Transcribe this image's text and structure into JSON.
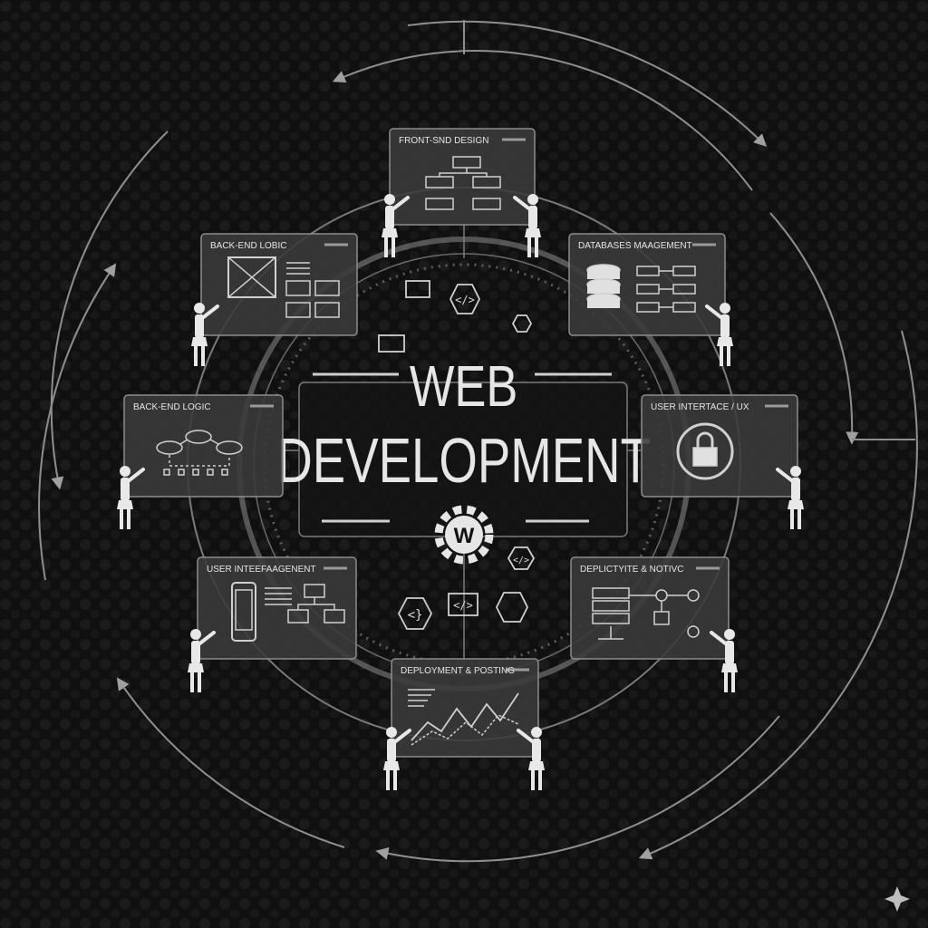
{
  "title": {
    "line1": "WEB",
    "line2": "DEVELOPMENT"
  },
  "center_logo_letter": "W",
  "panels": [
    {
      "id": "front-end-design",
      "label": "FRONT-SND DESIGN",
      "icon": "flowchart-icon"
    },
    {
      "id": "database-management",
      "label": "DATABASES MAAGEMENT",
      "icon": "database-icon"
    },
    {
      "id": "user-interface-ux",
      "label": "USER INTERTACE / UX",
      "icon": "lock-icon"
    },
    {
      "id": "deployment-hosting-right",
      "label": "DEPLICTYITE & NOTIVC",
      "icon": "server-icon"
    },
    {
      "id": "deployment-hosting",
      "label": "DEPLOYMENT & POSTING",
      "icon": "line-chart-icon"
    },
    {
      "id": "user-management",
      "label": "USER INTEEFAAGENENT",
      "icon": "mobile-icon"
    },
    {
      "id": "back-end-logic-left",
      "label": "BACK-END LOGIC",
      "icon": "workflow-icon"
    },
    {
      "id": "back-end-logic-top",
      "label": "BACK-END LOBIC",
      "icon": "wireframe-icon"
    }
  ],
  "code_glyphs": {
    "top": "</>",
    "small_right": "</>",
    "bottom_left": "<}",
    "bottom_mid": "</>"
  },
  "colors": {
    "background": "#101010",
    "panel_fill": "#3a3a3a",
    "panel_stroke": "#8c8c8c",
    "line": "#9a9a9a",
    "text": "#e6e6e6",
    "figure": "#e8e8e8"
  }
}
